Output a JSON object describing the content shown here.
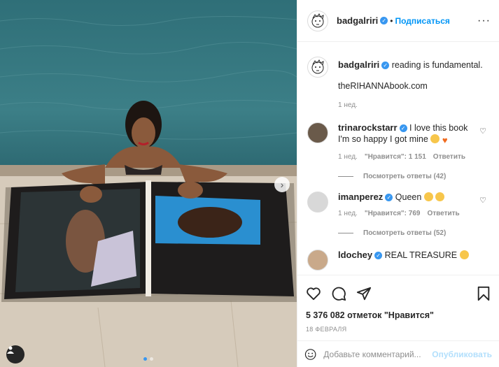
{
  "post": {
    "author": "badgalriri",
    "follow_label": "Подписаться",
    "more": "···",
    "caption": "reading is fundamental.",
    "caption_link": "theRIHANNAbook.com",
    "caption_time": "1 нед."
  },
  "comments": [
    {
      "user": "trinarockstarr",
      "text": "I love this book I'm so happy I got mine",
      "time": "1 нед.",
      "likes": "\"Нравится\": 1 151",
      "reply": "Ответить",
      "view_replies": "Посмотреть ответы (42)"
    },
    {
      "user": "imanperez",
      "text": "Queen",
      "time": "1 нед.",
      "likes": "\"Нравится\": 769",
      "reply": "Ответить",
      "view_replies": "Посмотреть ответы (52)"
    },
    {
      "user": "ldochey",
      "text": "REAL TREASURE"
    }
  ],
  "likes_count": "5 376 082 отметок \"Нравится\"",
  "date": "18 ФЕВРАЛЯ",
  "add_comment": {
    "placeholder": "Добавьте комментарий...",
    "publish_label": "Опубликовать"
  },
  "icons": [
    "heart-icon",
    "comment-icon",
    "share-icon",
    "bookmark-icon",
    "smile-icon",
    "user-tag-icon",
    "chevron-right-icon"
  ],
  "colors": {
    "accent": "#0095f6",
    "verified": "#3897f0",
    "muted": "#8e8e8e",
    "border": "#efefef"
  }
}
